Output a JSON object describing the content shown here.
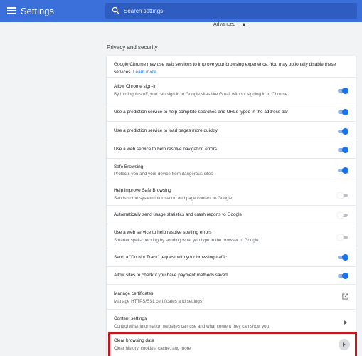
{
  "header": {
    "title": "Settings",
    "search_placeholder": "Search settings"
  },
  "advanced": {
    "label": "Advanced"
  },
  "section": {
    "title": "Privacy and security"
  },
  "intro": {
    "text": "Google Chrome may use web services to improve your browsing experience. You may optionally disable these services.",
    "link": "Learn more"
  },
  "rows": [
    {
      "title": "Allow Chrome sign-in",
      "subtitle": "By turning this off, you can sign in to Google sites like Gmail without signing in to Chrome",
      "control": "toggle",
      "on": true
    },
    {
      "title": "Use a prediction service to help complete searches and URLs typed in the address bar",
      "control": "toggle",
      "on": true
    },
    {
      "title": "Use a prediction service to load pages more quickly",
      "control": "toggle",
      "on": true
    },
    {
      "title": "Use a web service to help resolve navigation errors",
      "control": "toggle",
      "on": true
    },
    {
      "title": "Safe Browsing",
      "subtitle": "Protects you and your device from dangerous sites",
      "control": "toggle",
      "on": true
    },
    {
      "title": "Help improve Safe Browsing",
      "subtitle": "Sends some system information and page content to Google",
      "control": "toggle",
      "on": false
    },
    {
      "title": "Automatically send usage statistics and crash reports to Google",
      "control": "toggle",
      "on": false
    },
    {
      "title": "Use a web service to help resolve spelling errors",
      "subtitle": "Smarter spell-checking by sending what you type in the browser to Google",
      "control": "toggle",
      "on": false
    },
    {
      "title": "Send a \"Do Not Track\" request with your browsing traffic",
      "control": "toggle",
      "on": true
    },
    {
      "title": "Allow sites to check if you have payment methods saved",
      "control": "toggle",
      "on": true
    },
    {
      "title": "Manage certificates",
      "subtitle": "Manage HTTPS/SSL certificates and settings",
      "control": "external"
    },
    {
      "title": "Content settings",
      "subtitle": "Control what information websites can use and what content they can show you",
      "control": "arrow"
    },
    {
      "title": "Clear browsing data",
      "subtitle": "Clear history, cookies, cache, and more",
      "control": "arrow-circle"
    }
  ],
  "colors": {
    "header": "#3b6fd9",
    "toggle_on": "#1a73e8",
    "highlight": "#c5161d"
  },
  "icons": {
    "menu": "menu-icon",
    "search": "search-icon",
    "advanced": "caret-up-icon",
    "external": "open-in-new-icon",
    "arrow": "chevron-right-icon"
  }
}
